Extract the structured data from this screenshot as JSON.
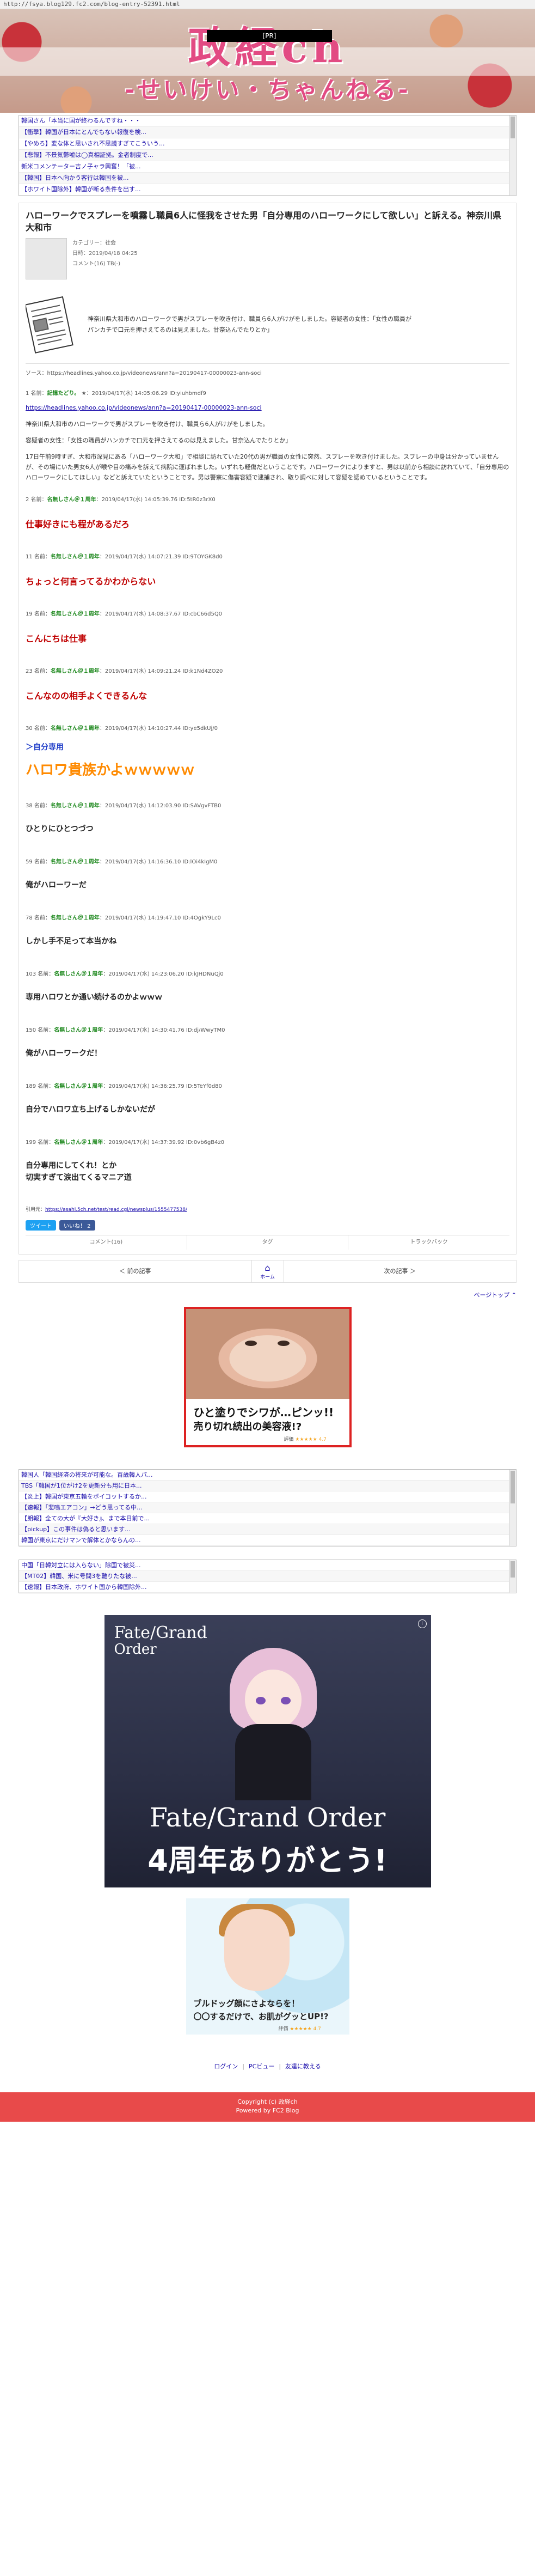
{
  "url": "http://fsya.blog129.fc2.com/blog-entry-52391.html",
  "banner": {
    "title": "政経ch",
    "subtitle": "-せいけい・ちゃんねる-",
    "tag": "[PR]"
  },
  "top_links": [
    "韓国さん「本当に国が終わるんですね・・・",
    "【衝撃】韓国が日本にとんでもない報復を検...",
    "【やめろ】変な体と思いされ不思議すぎてこういう...",
    "【悲報】不景気鬱嘘は◯真相証拠。金者制度で...",
    "新米コメンテーター吉ノ子ャラ興奮！「被...",
    "【韓国】日本へ向かう客行は韓国を被...",
    "【ホワイト国除外】韓国が断る条件を出す..."
  ],
  "article": {
    "title": "ハローワークでスプレーを噴霧し職員6人に怪我をさせた男「自分専用のハローワークにして欲しい」と訴える。神奈川県大和市",
    "category": "カテゴリー：社会",
    "date": "日時：2019/04/18 04:25",
    "comments": "コメント(16) TB(-)",
    "summary_line1": "神奈川県大和市のハローワークで男がスプレーを吹き付け、職員ら6人がけがをしました。容疑者の女性：「女性の職員が",
    "summary_line2": "パンカチで口元を押さえてるのは見えました。甘奈込んでたりとか」",
    "source_label": "ソース：",
    "source_url": "https://headlines.yahoo.co.jp/videonews/ann?a=20190417-00000023-ann-soci"
  },
  "comments": [
    {
      "num": "1",
      "name": "記憶たどり。",
      "star": "★",
      "time": "2019/04/17(水) 14:05:06.29 ID:yiuhbmdf9",
      "body": [
        "https://headlines.yahoo.co.jp/videonews/ann?a=20190417-00000023-ann-soci",
        "神奈川県大和市のハローワークで男がスプレーを吹き付け、職員ら6人がけがをしました。",
        "容疑者の女性：「女性の職員がハンカチで口元を押さえてるのは見えました。甘奈込んでたりとか」",
        "17日午前9時すぎ、大和市深見にある「ハローワーク大和」で相談に訪れていた20代の男が職員の女性に突然、スプレーを吹き付けました。スプレーの中身は分かっていませんが、その場にいた男女6人が喉や目の痛みを訴えて病院に運ばれました。いずれも軽傷だということです。ハローワークによりますと、男は以前から相談に訪れていて、「自分専用のハローワークにしてほしい」などと訴えていたということです。男は警察に傷害容疑で逮捕され、取り調べに対して容疑を認めているということです。"
      ]
    },
    {
      "num": "2",
      "name": "名無しさん＠１周年",
      "time": "2019/04/17(水) 14:05:39.76 ID:5tR0z3rX0",
      "text": "仕事好きにも程があるだろ",
      "style": "red"
    },
    {
      "num": "11",
      "name": "名無しさん＠１周年",
      "time": "2019/04/17(水) 14:07:21.39 ID:9TOYGK8d0",
      "text": "ちょっと何言ってるかわからない",
      "style": "red"
    },
    {
      "num": "19",
      "name": "名無しさん＠１周年",
      "time": "2019/04/17(水) 14:08:37.67 ID:cbC66d5Q0",
      "text": "こんにちは仕事",
      "style": "red"
    },
    {
      "num": "23",
      "name": "名無しさん＠１周年",
      "time": "2019/04/17(水) 14:09:21.24 ID:k1Nd4ZO20",
      "text": "こんなのの相手よくできるんな",
      "style": "red"
    },
    {
      "num": "30",
      "name": "名無しさん＠１周年",
      "time": "2019/04/17(水) 14:10:27.44 ID:ye5dkUj/0",
      "anchor": "＞自分専用",
      "text": "ハロワ貴族かよｗｗｗｗｗ",
      "style": "orange"
    },
    {
      "num": "38",
      "name": "名無しさん＠１周年",
      "time": "2019/04/17(水) 14:12:03.90 ID:SAVgvFTB0",
      "text": "ひとりにひとつづつ",
      "style": "black"
    },
    {
      "num": "59",
      "name": "名無しさん＠１周年",
      "time": "2019/04/17(水) 14:16:36.10 ID:lOi4kIgM0",
      "text": "俺がハローワーだ",
      "style": "black"
    },
    {
      "num": "78",
      "name": "名無しさん＠１周年",
      "time": "2019/04/17(水) 14:19:47.10 ID:4OgkY9Lc0",
      "text": "しかし手不足って本当かね",
      "style": "black"
    },
    {
      "num": "103",
      "name": "名無しさん＠１周年",
      "time": "2019/04/17(水) 14:23:06.20 ID:kJHDNuQj0",
      "text": "専用ハロワとか通い続けるのかよｗｗｗ",
      "style": "black"
    },
    {
      "num": "150",
      "name": "名無しさん＠１周年",
      "time": "2019/04/17(水) 14:30:41.76 ID:dj/WwyTM0",
      "text": "俺がハローワークだ！",
      "style": "black"
    },
    {
      "num": "189",
      "name": "名無しさん＠１周年",
      "time": "2019/04/17(水) 14:36:25.79 ID:5TeYf0d80",
      "text": "自分でハロワ立ち上げるしかないだが",
      "style": "black"
    },
    {
      "num": "199",
      "name": "名無しさん＠１周年",
      "time": "2019/04/17(水) 14:37:39.92 ID:0vb6gB4z0",
      "text": "自分専用にしてくれ！とか\n切実すぎて涙出てくるマニア道",
      "style": "black"
    }
  ],
  "ref": {
    "label": "引用元：",
    "url": "https://asahi.5ch.net/test/read.cgi/newsplus/1555477538/"
  },
  "social": {
    "tweet": "ツイート",
    "like": "いいね！ 2"
  },
  "actions": [
    "コメント(16)",
    "タグ",
    "トラックバック"
  ],
  "nav": {
    "prev": "＜ 前の記事",
    "home": "ホーム",
    "next": "次の記事 ＞"
  },
  "pagetop": "ページトップ ⌃",
  "ad1": {
    "line1": "ひと塗りでシワが…ピンッ!!",
    "line2": "売り切れ続出の美容液!?",
    "rating_label": "評価",
    "stars": "★★★★★ 4.7"
  },
  "bottom_links": [
    "韓国人「韓国経済の将来が可能な。百歳韓人パ...",
    "TBS「韓国が1位がけ2を更新分も用に日本...",
    "【炎上】韓国が東京五輪をボイコットするか...",
    "【速報】「悲鳴エアコン」→どう思ってる中...",
    "【朗報】全ての大が『大好き』、まで本日前で...",
    "【pickup】この事件は偽ると思います...",
    "韓国が東京にだけマンで解体とかならんの..."
  ],
  "bottom_links2": [
    "中国「日韓対立には入らない」除国で被災...",
    "【MT02】韓国、米に号間3を難りたな被...",
    "【速報】日本政府、ホワイト国から韓国除外..."
  ],
  "ad2": {
    "logo_top": "Fate/Grand",
    "logo_bottom": "Order",
    "title": "Fate/Grand Order",
    "title2": "4周年ありがとう!",
    "info": "i"
  },
  "ad3": {
    "line1": "ブルドッグ顔にさよならを！",
    "line2": "〇〇するだけで、お肌がグッとUP!?",
    "rating_label": "評価",
    "stars": "★★★★★ 4.7"
  },
  "footer_links": [
    "ログイン",
    "PCビュー",
    "友達に教える"
  ],
  "footer": {
    "copyright": "Copyright (c) 政経ch",
    "powered": "Powered by FC2 Blog"
  }
}
